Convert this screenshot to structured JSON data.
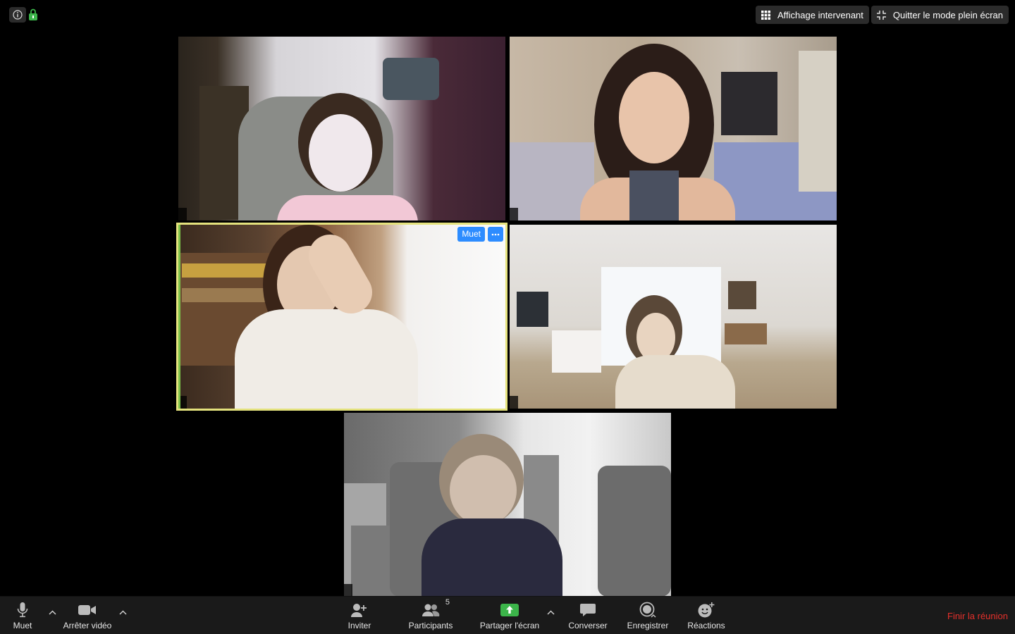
{
  "topbar": {
    "speaker_view_label": "Affichage intervenant",
    "exit_fullscreen_label": "Quitter le mode plein écran"
  },
  "tiles": [
    {
      "name": ""
    },
    {
      "name": ""
    },
    {
      "name": "",
      "active": true,
      "mute_label": "Muet"
    },
    {
      "name": ""
    },
    {
      "name": ""
    }
  ],
  "toolbar": {
    "mute_label": "Muet",
    "stop_video_label": "Arrêter vidéo",
    "invite_label": "Inviter",
    "participants_label": "Participants",
    "participants_count": "5",
    "share_label": "Partager l'écran",
    "chat_label": "Converser",
    "record_label": "Enregistrer",
    "reactions_label": "Réactions",
    "end_label": "Finir la réunion"
  },
  "colors": {
    "accent_blue": "#2d8cff",
    "share_green": "#3cb54a",
    "end_red": "#e5302b",
    "active_border": "#e4e27d"
  },
  "icons": [
    "info-icon",
    "lock-icon",
    "grid-icon",
    "collapse-icon",
    "more-icon",
    "microphone-icon",
    "caret-up-icon",
    "camera-icon",
    "add-user-icon",
    "participants-icon",
    "share-screen-icon",
    "chat-icon",
    "record-icon",
    "reaction-icon"
  ]
}
